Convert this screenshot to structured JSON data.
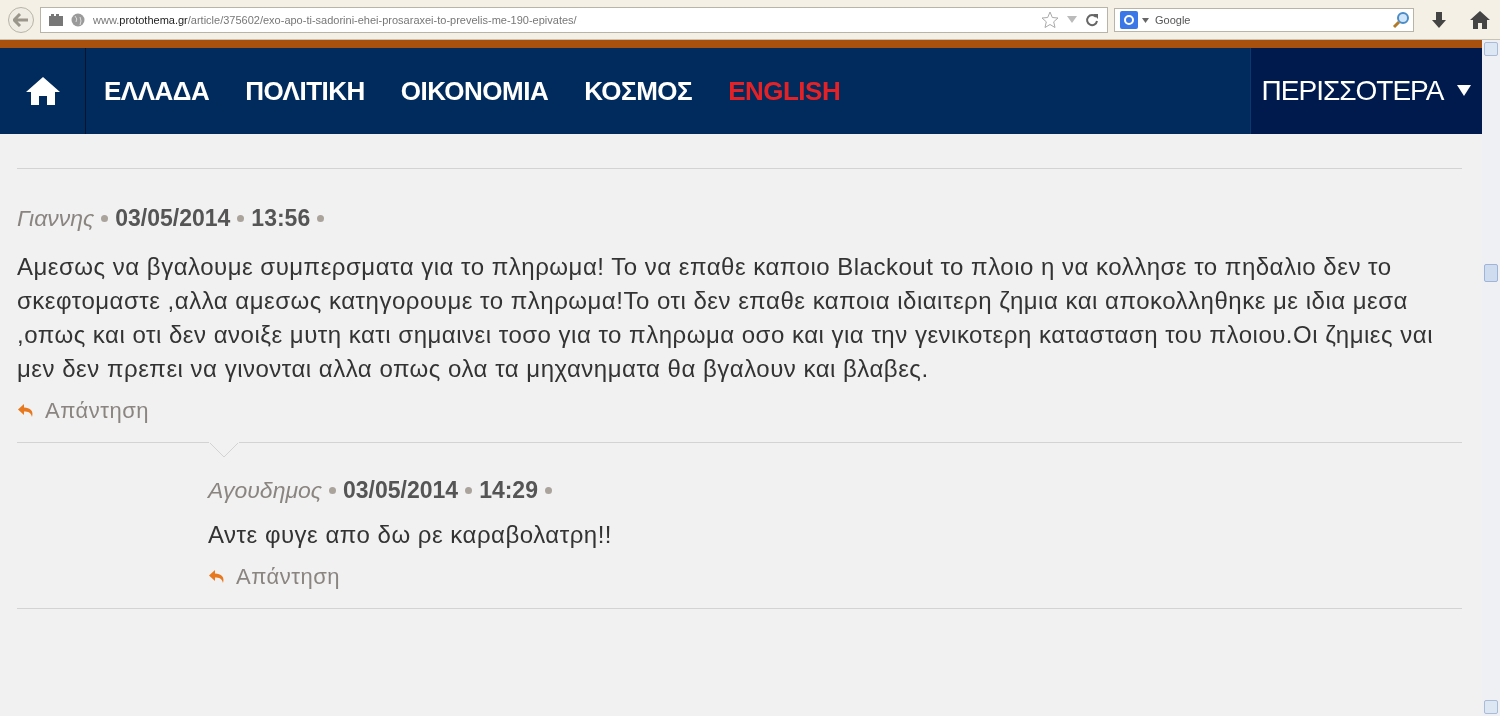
{
  "browser": {
    "url": "www.**protothema.gr**/article/375602/exo-apo-ti-sadorini-ehei-prosaraxei-to-prevelis-me-190-epivates/",
    "search_placeholder": "Google"
  },
  "nav": {
    "items": [
      {
        "label": "ΕΛΛΑΔΑ",
        "color": "#ffffff"
      },
      {
        "label": "ΠΟΛΙΤΙΚΗ",
        "color": "#ffffff"
      },
      {
        "label": "ΟΙΚΟΝΟΜΙΑ",
        "color": "#ffffff"
      },
      {
        "label": "ΚΟΣΜΟΣ",
        "color": "#ffffff"
      },
      {
        "label": "ENGLISH",
        "color": "#e32227"
      }
    ],
    "more": "ΠΕΡΙΣΣΟΤΕΡΑ"
  },
  "comments": [
    {
      "author": "Γιαννης",
      "date": "03/05/2014",
      "time": "13:56",
      "text": "Αμεσως να βγαλουμε συμπερσματα για το πληρωμα! Το να επαθε καποιο Blackout το πλοιο η να κολλησε το πηδαλιο δεν το σκεφτομαστε ,αλλα αμεσως κατηγορουμε το πληρωμα!Το οτι δεν επαθε καποια ιδιαιτερη ζημια και αποκολληθηκε με ιδια μεσα ,οπως και οτι δεν ανοιξε μυτη κατι σημαινει τοσο για το πληρωμα οσο και για την γενικοτερη κατασταση του πλοιου.Οι ζημιες ναι μεν δεν πρεπει να γινονται αλλα οπως ολα τα μηχανηματα θα βγαλουν και βλαβες.",
      "reply": "Απάντηση",
      "children": [
        {
          "author": "Αγουδημος",
          "date": "03/05/2014",
          "time": "14:29",
          "text": "Αντε φυγε απο δω ρε καραβολατρη!!",
          "reply": "Απάντηση"
        }
      ]
    }
  ]
}
